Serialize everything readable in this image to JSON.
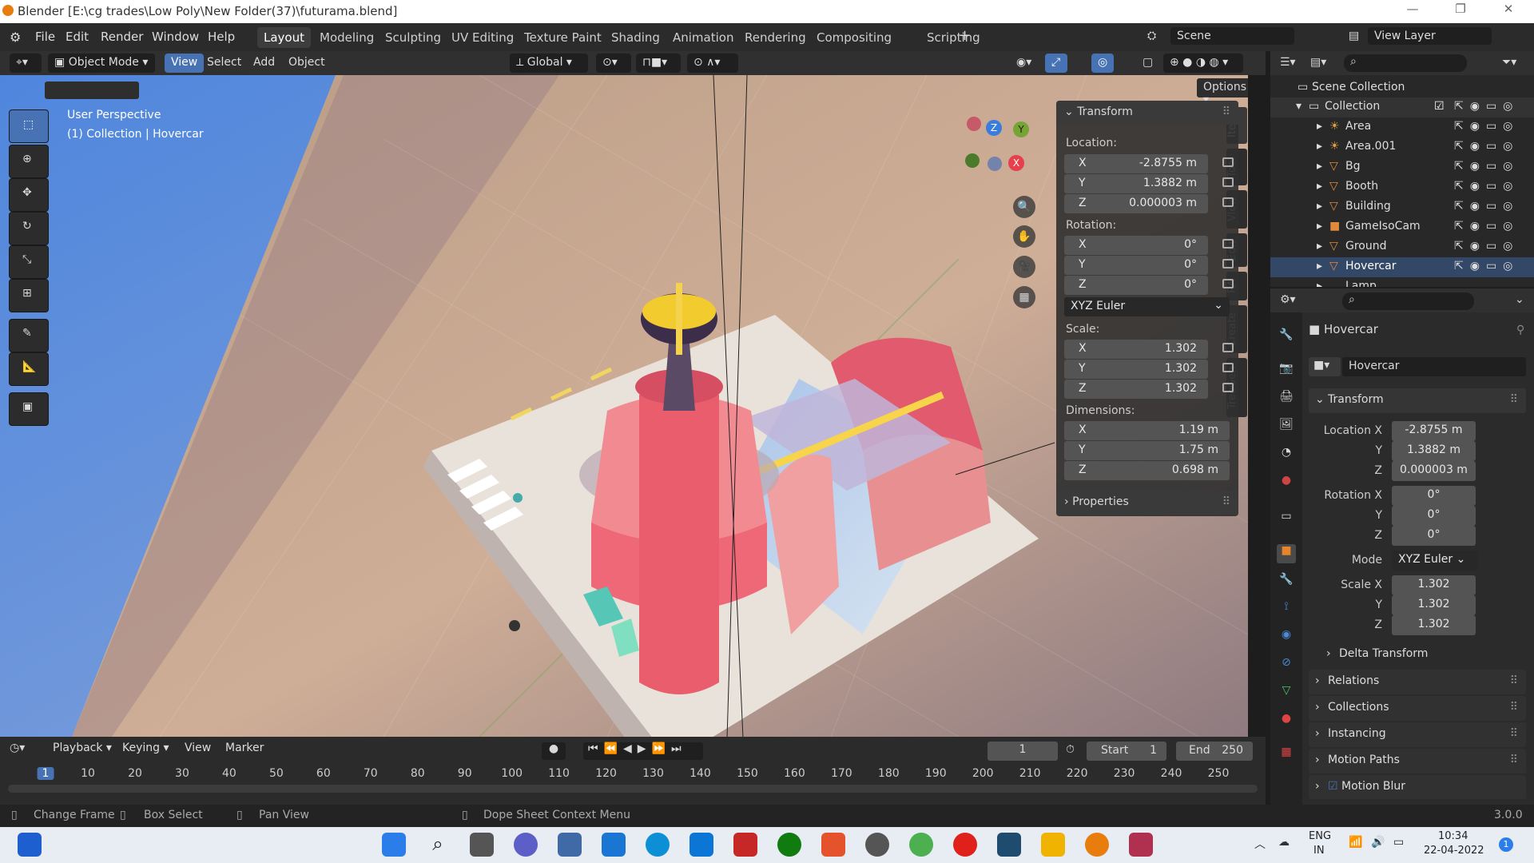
{
  "window": {
    "title": "Blender [E:\\cg trades\\Low Poly\\New Folder(37)\\futurama.blend]"
  },
  "menu": [
    "File",
    "Edit",
    "Render",
    "Window",
    "Help"
  ],
  "workspaces": [
    "Layout",
    "Modeling",
    "Sculpting",
    "UV Editing",
    "Texture Paint",
    "Shading",
    "Animation",
    "Rendering",
    "Compositing",
    "Scripting"
  ],
  "active_workspace": "Layout",
  "scene": "Scene",
  "view_layer": "View Layer",
  "viewport_header": {
    "mode": "Object Mode",
    "menus": [
      "View",
      "Select",
      "Add",
      "Object"
    ],
    "orientation": "Global",
    "options": "Options"
  },
  "viewport": {
    "perspective": "User Perspective",
    "context": "(1) Collection | Hovercar"
  },
  "gizmo": {
    "x": "X",
    "y": "Y",
    "z": "Z"
  },
  "npanel": {
    "tabs": [
      "Item",
      "Tool",
      "View",
      "Edit",
      "RA",
      "Create",
      "TreeGen"
    ],
    "transform_header": "Transform",
    "location_label": "Location:",
    "location": [
      {
        "axis": "X",
        "value": "-2.8755 m"
      },
      {
        "axis": "Y",
        "value": "1.3882 m"
      },
      {
        "axis": "Z",
        "value": "0.000003 m"
      }
    ],
    "rotation_label": "Rotation:",
    "rotation": [
      {
        "axis": "X",
        "value": "0°"
      },
      {
        "axis": "Y",
        "value": "0°"
      },
      {
        "axis": "Z",
        "value": "0°"
      }
    ],
    "rotation_mode": "XYZ Euler",
    "scale_label": "Scale:",
    "scale": [
      {
        "axis": "X",
        "value": "1.302"
      },
      {
        "axis": "Y",
        "value": "1.302"
      },
      {
        "axis": "Z",
        "value": "1.302"
      }
    ],
    "dimensions_label": "Dimensions:",
    "dimensions": [
      {
        "axis": "X",
        "value": "1.19 m"
      },
      {
        "axis": "Y",
        "value": "1.75 m"
      },
      {
        "axis": "Z",
        "value": "0.698 m"
      }
    ],
    "properties_header": "Properties"
  },
  "outliner": {
    "scene_collection": "Scene Collection",
    "collection": "Collection",
    "items": [
      "Area",
      "Area.001",
      "Bg",
      "Booth",
      "Building",
      "GameIsoCam",
      "Ground",
      "Hovercar",
      "Lamp"
    ]
  },
  "properties": {
    "object_name": "Hovercar",
    "datablock": "Hovercar",
    "transform_header": "Transform",
    "location_x_label": "Location X",
    "location": [
      "-2.8755 m",
      "1.3882 m",
      "0.000003 m"
    ],
    "rotation_x_label": "Rotation X",
    "rotation": [
      "0°",
      "0°",
      "0°"
    ],
    "mode_label": "Mode",
    "mode": "XYZ Euler",
    "scale_x_label": "Scale X",
    "scale": [
      "1.302",
      "1.302",
      "1.302"
    ],
    "y_label": "Y",
    "z_label": "Z",
    "sections": [
      "Delta Transform",
      "Relations",
      "Collections",
      "Instancing",
      "Motion Paths",
      "Motion Blur"
    ]
  },
  "timeline": {
    "menus": [
      "Playback",
      "Keying",
      "View",
      "Marker"
    ],
    "current_frame": "1",
    "start_label": "Start",
    "start": "1",
    "end_label": "End",
    "end": "250",
    "ticks": [
      "1",
      "10",
      "20",
      "30",
      "40",
      "50",
      "60",
      "70",
      "80",
      "90",
      "100",
      "110",
      "120",
      "130",
      "140",
      "150",
      "160",
      "170",
      "180",
      "190",
      "200",
      "210",
      "220",
      "230",
      "240",
      "250"
    ]
  },
  "status": {
    "change_frame": "Change Frame",
    "box_select": "Box Select",
    "pan_view": "Pan View",
    "context_menu": "Dope Sheet Context Menu",
    "version": "3.0.0"
  },
  "taskbar": {
    "lang": "ENG",
    "region": "IN",
    "time": "10:34",
    "date": "22-04-2022",
    "notification_count": "1"
  },
  "colors": {
    "accent": "#4772b3",
    "brand": "#e87d0d",
    "header": "#303030",
    "panel": "#2b2b2b"
  }
}
